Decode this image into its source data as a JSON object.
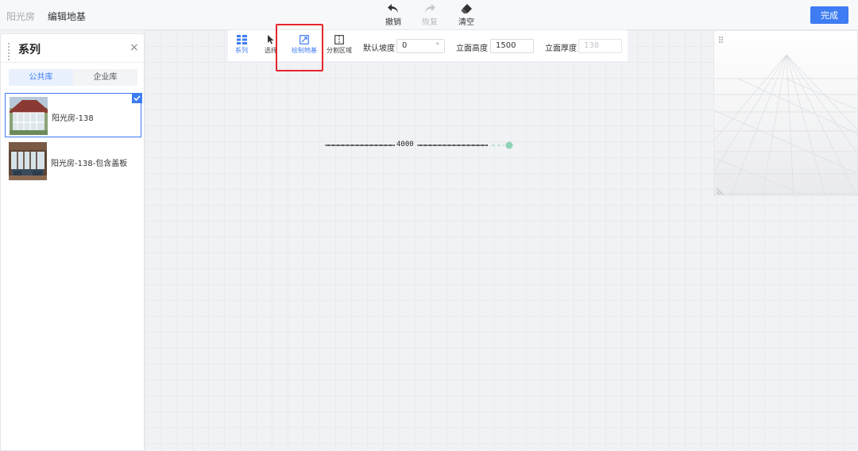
{
  "breadcrumb": {
    "root": "阳光房",
    "current": "编辑地基"
  },
  "history": {
    "undo_label": "撤销",
    "redo_label": "恢复",
    "clear_label": "清空"
  },
  "done_label": "完成",
  "panel": {
    "title": "系列",
    "close_glyph": "×",
    "tabs": [
      {
        "label": "公共库",
        "active": true
      },
      {
        "label": "企业库",
        "active": false
      }
    ],
    "items": [
      {
        "name": "阳光房-138",
        "selected": true
      },
      {
        "name": "阳光房-138-包含盖板",
        "selected": false
      }
    ]
  },
  "toolbar": {
    "series_label": "系列",
    "select_label": "选择",
    "draw_base_label": "绘制地基",
    "split_area_label": "分割区域",
    "slope_label": "默认坡度",
    "slope_value": "0",
    "slope_unit": "°",
    "height_label": "立面高度",
    "height_value": "1500",
    "thickness_label": "立面厚度",
    "thickness_value": "138"
  },
  "drawing": {
    "dimension": "4000"
  },
  "colors": {
    "accent": "#3d7cf2",
    "highlight": "#e6262b",
    "endpoint": "#8fd2b6"
  }
}
